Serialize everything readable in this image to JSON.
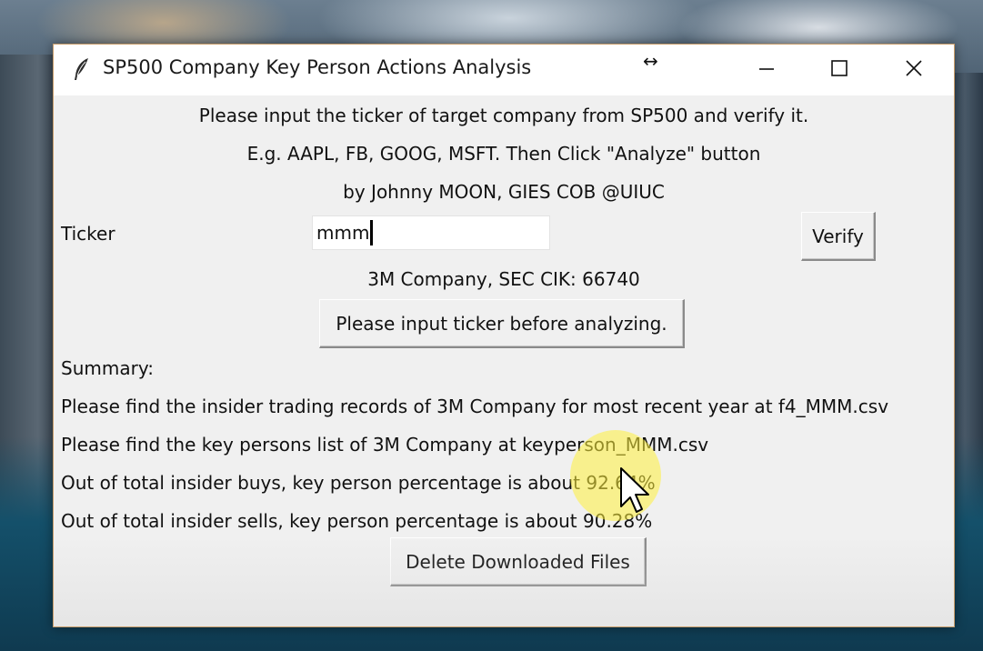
{
  "window": {
    "title": "SP500 Company Key Person Actions Analysis",
    "icon": "feather-icon",
    "controls": [
      "resize-arrows-icon",
      "minimize-icon",
      "maximize-icon",
      "close-icon"
    ],
    "resize_glyph": "↔"
  },
  "header": {
    "line1": "Please input the ticker of target company from SP500 and verify it.",
    "line2": "E.g. AAPL, FB, GOOG, MSFT. Then Click \"Analyze\" button",
    "line3": "by Johnny MOON, GIES COB @UIUC"
  },
  "ticker": {
    "label": "Ticker",
    "value": "mmm",
    "verify_label": "Verify"
  },
  "company_info": "3M Company, SEC CIK: 66740",
  "analyze_button_label": "Please input ticker before analyzing.",
  "summary": {
    "heading": "Summary:",
    "lines": [
      "Please find the insider trading records of 3M Company for most recent year at f4_MMM.csv",
      "Please find the key persons list of 3M Company at keyperson_MMM.csv",
      "Out of total insider buys, key person percentage is about 92.64%",
      "Out of total insider sells, key person percentage is about 90.28%"
    ]
  },
  "delete_button_label": "Delete Downloaded Files",
  "colors": {
    "window_bg": "#f0f0f0",
    "titlebar_bg": "#ffffff",
    "border_accent": "#c79c6a",
    "cursor_highlight": "#fff03c"
  }
}
